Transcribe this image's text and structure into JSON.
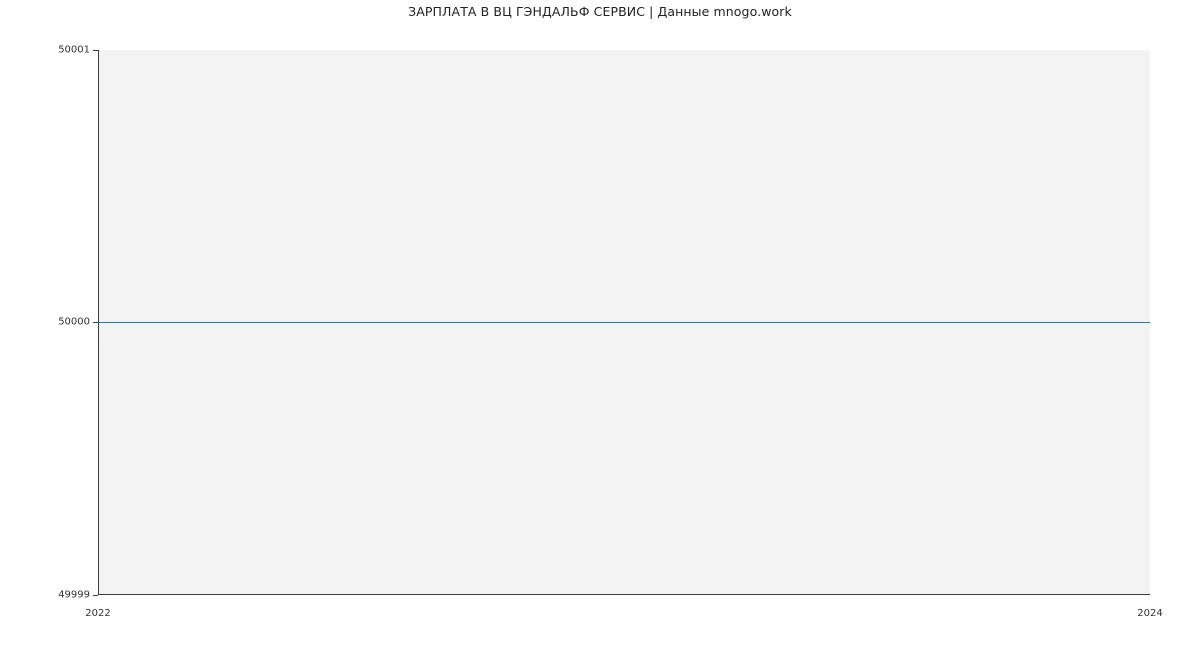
{
  "chart_data": {
    "type": "line",
    "title": "ЗАРПЛАТА В ВЦ ГЭНДАЛЬФ СЕРВИС | Данные mnogo.work",
    "xlabel": "",
    "ylabel": "",
    "x": [
      2022,
      2024
    ],
    "series": [
      {
        "name": "",
        "values": [
          50000,
          50000
        ],
        "color": "#1f77b4"
      }
    ],
    "x_ticks": [
      2022,
      2024
    ],
    "y_ticks": [
      49999,
      50000,
      50001
    ],
    "xlim": [
      2022,
      2024
    ],
    "ylim": [
      49999,
      50001
    ],
    "grid": false,
    "background": "#f3f3f3"
  },
  "ticks": {
    "y0": "49999",
    "y1": "50000",
    "y2": "50001",
    "x0": "2022",
    "x1": "2024"
  }
}
